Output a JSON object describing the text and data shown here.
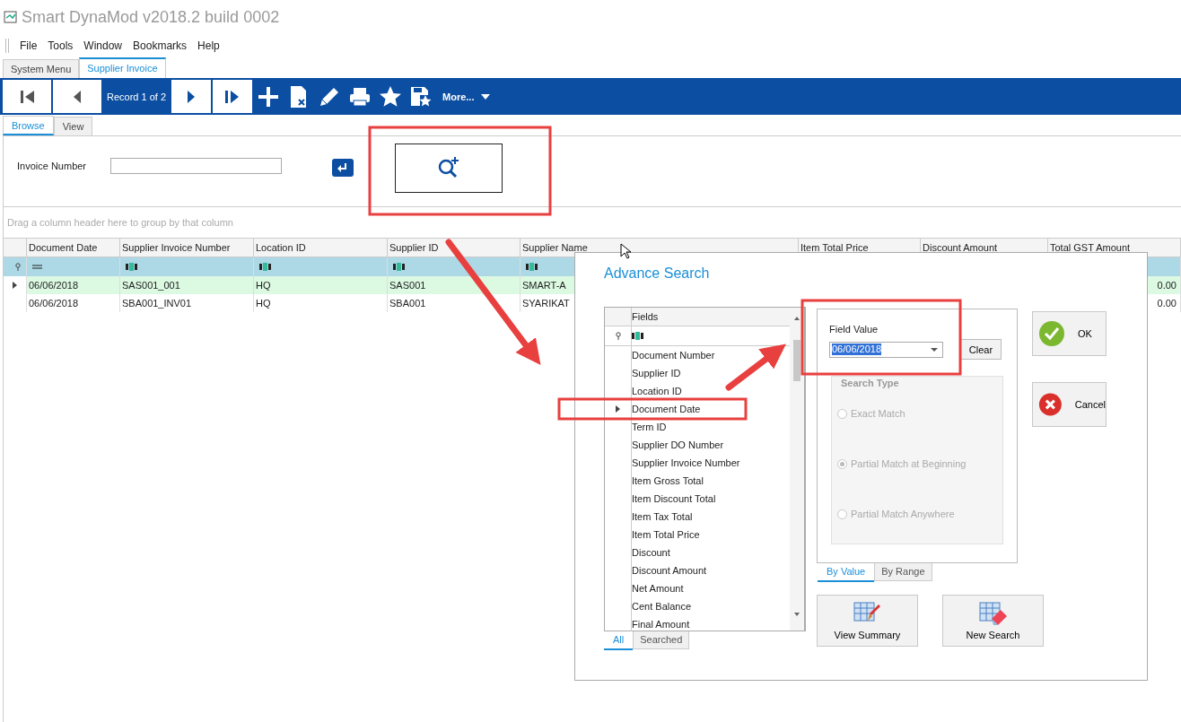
{
  "window": {
    "title": "Smart DynaMod v2018.2 build 0002"
  },
  "menu": [
    "File",
    "Tools",
    "Window",
    "Bookmarks",
    "Help"
  ],
  "doc_tabs": [
    {
      "label": "System Menu",
      "selected": false
    },
    {
      "label": "Supplier Invoice",
      "selected": true
    }
  ],
  "toolbar": {
    "record_label": "Record 1 of 2",
    "more_label": "More..."
  },
  "view_tabs": [
    {
      "label": "Browse",
      "selected": true
    },
    {
      "label": "View",
      "selected": false
    }
  ],
  "search_panel": {
    "label": "Invoice Number"
  },
  "grid": {
    "group_hint": "Drag a column header here to group by that column",
    "columns": [
      {
        "label": "Document Date",
        "kind": "equals"
      },
      {
        "label": "Supplier Invoice Number",
        "kind": "text"
      },
      {
        "label": "Location ID",
        "kind": "text"
      },
      {
        "label": "Supplier ID",
        "kind": "text"
      },
      {
        "label": "Supplier Name",
        "kind": "text"
      },
      {
        "label": "Item Total Price",
        "kind": "hidden"
      },
      {
        "label": "Discount Amount",
        "kind": "hidden"
      },
      {
        "label": "Total GST Amount",
        "kind": "hidden"
      }
    ],
    "rows": [
      {
        "selected": true,
        "cells": [
          "06/06/2018",
          "SAS001_001",
          "HQ",
          "SAS001",
          "SMART-A",
          null,
          null,
          "0.00"
        ]
      },
      {
        "selected": false,
        "cells": [
          "06/06/2018",
          "SBA001_INV01",
          "HQ",
          "SBA001",
          "SYARIKAT",
          null,
          null,
          "0.00"
        ]
      }
    ]
  },
  "dialog": {
    "title": "Advance Search",
    "fields": {
      "header": "Fields",
      "items": [
        {
          "label": "Document Number",
          "selected": false
        },
        {
          "label": "Supplier ID",
          "selected": false
        },
        {
          "label": "Location ID",
          "selected": false
        },
        {
          "label": "Document Date",
          "selected": true
        },
        {
          "label": "Term ID",
          "selected": false
        },
        {
          "label": "Supplier DO Number",
          "selected": false
        },
        {
          "label": "Supplier Invoice Number",
          "selected": false
        },
        {
          "label": "Item Gross Total",
          "selected": false
        },
        {
          "label": "Item Discount Total",
          "selected": false
        },
        {
          "label": "Item Tax Total",
          "selected": false
        },
        {
          "label": "Item Total Price",
          "selected": false
        },
        {
          "label": "Discount",
          "selected": false
        },
        {
          "label": "Discount Amount",
          "selected": false
        },
        {
          "label": "Net Amount",
          "selected": false
        },
        {
          "label": "Cent Balance",
          "selected": false
        },
        {
          "label": "Final Amount",
          "selected": false
        }
      ],
      "tabs": [
        {
          "label": "All",
          "selected": true
        },
        {
          "label": "Searched",
          "selected": false
        }
      ]
    },
    "field_value": {
      "label": "Field Value",
      "value": "06/06/2018",
      "clear": "Clear"
    },
    "search_type": {
      "label": "Search Type",
      "disabled": true,
      "options": [
        {
          "label": "Exact Match",
          "selected": false
        },
        {
          "label": "Partial Match at Beginning",
          "selected": true
        },
        {
          "label": "Partial Match Anywhere",
          "selected": false
        }
      ]
    },
    "mode_tabs": [
      {
        "label": "By Value",
        "selected": true
      },
      {
        "label": "By Range",
        "selected": false
      }
    ],
    "buttons": [
      {
        "kind": "ok",
        "label": "OK"
      },
      {
        "kind": "cancel",
        "label": "Cancel"
      }
    ],
    "bottom_buttons": [
      {
        "kind": "summary",
        "label": "View Summary"
      },
      {
        "kind": "new",
        "label": "New Search"
      }
    ]
  }
}
